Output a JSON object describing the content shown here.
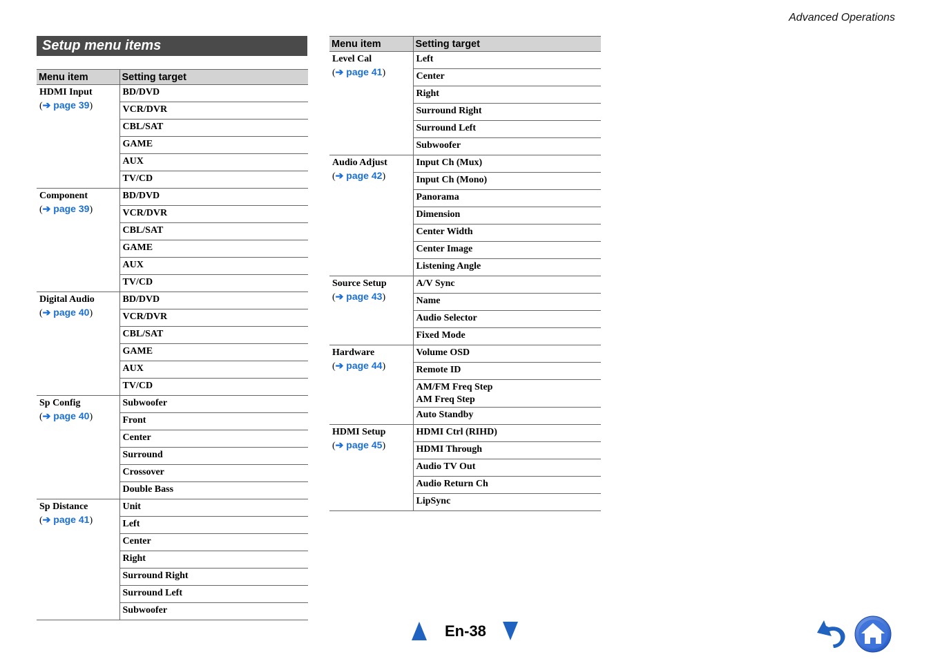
{
  "header": {
    "running_title": "Advanced Operations"
  },
  "section": {
    "title": "Setup menu items"
  },
  "columns": {
    "menu_item": "Menu item",
    "setting_target": "Setting target"
  },
  "left_table": [
    {
      "item": "HDMI Input",
      "page": "page 39",
      "targets": [
        "BD/DVD",
        "VCR/DVR",
        "CBL/SAT",
        "GAME",
        "AUX",
        "TV/CD"
      ]
    },
    {
      "item": "Component",
      "page": "page 39",
      "targets": [
        "BD/DVD",
        "VCR/DVR",
        "CBL/SAT",
        "GAME",
        "AUX",
        "TV/CD"
      ]
    },
    {
      "item": "Digital Audio",
      "page": "page 40",
      "targets": [
        "BD/DVD",
        "VCR/DVR",
        "CBL/SAT",
        "GAME",
        "AUX",
        "TV/CD"
      ]
    },
    {
      "item": "Sp Config",
      "page": "page 40",
      "targets": [
        "Subwoofer",
        "Front",
        "Center",
        "Surround",
        "Crossover",
        "Double Bass"
      ]
    },
    {
      "item": "Sp Distance",
      "page": "page 41",
      "targets": [
        "Unit",
        "Left",
        "Center",
        "Right",
        "Surround Right",
        "Surround Left",
        "Subwoofer"
      ]
    }
  ],
  "right_table": [
    {
      "item": "Level Cal",
      "page": "page 41",
      "targets": [
        "Left",
        "Center",
        "Right",
        "Surround Right",
        "Surround Left",
        "Subwoofer"
      ]
    },
    {
      "item": "Audio Adjust",
      "page": "page 42",
      "targets": [
        "Input Ch (Mux)",
        "Input Ch (Mono)",
        "Panorama",
        "Dimension",
        "Center Width",
        "Center Image",
        "Listening Angle"
      ]
    },
    {
      "item": "Source Setup",
      "page": "page 43",
      "targets": [
        "A/V Sync",
        "Name",
        "Audio Selector",
        "Fixed Mode"
      ]
    },
    {
      "item": "Hardware",
      "page": "page 44",
      "targets": [
        "Volume OSD",
        "Remote ID",
        "AM/FM Freq Step\nAM Freq Step",
        "Auto Standby"
      ]
    },
    {
      "item": "HDMI Setup",
      "page": "page 45",
      "targets": [
        "HDMI Ctrl (RIHD)",
        "HDMI Through",
        "Audio TV Out",
        "Audio Return Ch",
        "LipSync"
      ]
    }
  ],
  "link_arrow": "➔",
  "footer": {
    "page_number": "En-38",
    "prev_icon": "triangle-up",
    "next_icon": "triangle-down",
    "back_icon": "curved-back-arrow",
    "home_icon": "home"
  },
  "colors": {
    "link": "#1a6fd6",
    "nav_blue": "#1f62c0",
    "title_bar": "#4a4a4a",
    "header_row": "#d3d3d3"
  }
}
